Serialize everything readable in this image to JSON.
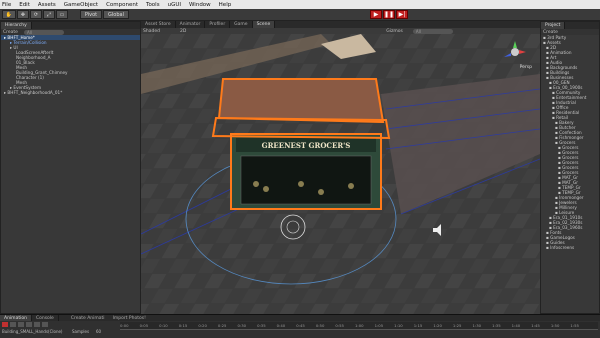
{
  "menu": [
    "File",
    "Edit",
    "Assets",
    "GameObject",
    "Component",
    "Tools",
    "uGUI",
    "Window",
    "Help"
  ],
  "toolbar": {
    "pivot": "Pivot",
    "global": "Global"
  },
  "hierarchy": {
    "tab": "Hierarchy",
    "create": "Create",
    "search": "All",
    "items": [
      {
        "label": "BHFT_Home*",
        "indent": 0,
        "cls": "sel"
      },
      {
        "label": "Terrain/Collision",
        "indent": 1,
        "cls": "blue"
      },
      {
        "label": "UI",
        "indent": 1,
        "cls": ""
      },
      {
        "label": "LoadScreenAfterIt",
        "indent": 2,
        "cls": ""
      },
      {
        "label": "Neighborhood_A",
        "indent": 2,
        "cls": ""
      },
      {
        "label": "01_Black",
        "indent": 2,
        "cls": ""
      },
      {
        "label": "Mesh",
        "indent": 2,
        "cls": ""
      },
      {
        "label": "Building_Grant_Chimney",
        "indent": 2,
        "cls": ""
      },
      {
        "label": "Character (1)",
        "indent": 2,
        "cls": ""
      },
      {
        "label": "Mesh",
        "indent": 2,
        "cls": ""
      },
      {
        "label": "EventSystem",
        "indent": 1,
        "cls": ""
      },
      {
        "label": "BHFT_NeighborhoodA_01*",
        "indent": 0,
        "cls": ""
      }
    ]
  },
  "scene": {
    "tabs": [
      "Asset Store",
      "Animator",
      "Profiler",
      "Game",
      "Scene"
    ],
    "shading": "Shaded",
    "mode": "2D",
    "gizmos": "Gizmos",
    "search": "All",
    "persp": "Persp",
    "sign": "GREENEST GROCER'S"
  },
  "project": {
    "tab": "Project",
    "create": "Create",
    "items": [
      {
        "label": "3rd Party",
        "indent": 0
      },
      {
        "label": "Assets",
        "indent": 0
      },
      {
        "label": "2D",
        "indent": 1
      },
      {
        "label": "Animation",
        "indent": 1
      },
      {
        "label": "Art",
        "indent": 1
      },
      {
        "label": "Audio",
        "indent": 1
      },
      {
        "label": "Backgrounds",
        "indent": 1
      },
      {
        "label": "Buildings",
        "indent": 1
      },
      {
        "label": "Businesses",
        "indent": 1
      },
      {
        "label": "00_GEN",
        "indent": 2
      },
      {
        "label": "Era_00_1900s",
        "indent": 2
      },
      {
        "label": "Community",
        "indent": 3
      },
      {
        "label": "Entertainment",
        "indent": 3
      },
      {
        "label": "Industrial",
        "indent": 3
      },
      {
        "label": "Office",
        "indent": 3
      },
      {
        "label": "Residential",
        "indent": 3
      },
      {
        "label": "Retail",
        "indent": 3
      },
      {
        "label": "Bakery",
        "indent": 4
      },
      {
        "label": "Butcher",
        "indent": 4
      },
      {
        "label": "Confection",
        "indent": 4
      },
      {
        "label": "Fishmonger",
        "indent": 4
      },
      {
        "label": "Grocers",
        "indent": 4
      },
      {
        "label": "Grocers",
        "indent": 5
      },
      {
        "label": "Grocers",
        "indent": 5
      },
      {
        "label": "Grocers",
        "indent": 5
      },
      {
        "label": "Grocers",
        "indent": 5
      },
      {
        "label": "Grocers",
        "indent": 5
      },
      {
        "label": "Grocers",
        "indent": 5
      },
      {
        "label": "MAT_Gr",
        "indent": 5
      },
      {
        "label": "MAT_Gr",
        "indent": 5
      },
      {
        "label": "TEMP_Gr",
        "indent": 5
      },
      {
        "label": "TEMP_Gr",
        "indent": 5
      },
      {
        "label": "Ironmonger",
        "indent": 4
      },
      {
        "label": "Jewelers",
        "indent": 4
      },
      {
        "label": "Millinery",
        "indent": 4
      },
      {
        "label": "Leisure",
        "indent": 4
      },
      {
        "label": "Era_01_1910s",
        "indent": 2
      },
      {
        "label": "Era_02_1930s",
        "indent": 2
      },
      {
        "label": "Era_03_1960s",
        "indent": 2
      },
      {
        "label": "Fonts",
        "indent": 1
      },
      {
        "label": "GameLogos",
        "indent": 1
      },
      {
        "label": "Guides",
        "indent": 1
      },
      {
        "label": "Infoscreens",
        "indent": 1
      }
    ]
  },
  "bottom": {
    "tabs": [
      "Animation",
      "Console"
    ],
    "create_anim": "Create Animati",
    "import": "Import Photos!",
    "clip": "Building_SMALL_Hands(Clone)",
    "samples": "Samples",
    "samples_val": "60",
    "ticks": [
      "0:00",
      "0:05",
      "0:10",
      "0:15",
      "0:20",
      "0:25",
      "0:30",
      "0:35",
      "0:40",
      "0:45",
      "0:50",
      "0:55",
      "1:00",
      "1:05",
      "1:10",
      "1:15",
      "1:20",
      "1:25",
      "1:30",
      "1:35",
      "1:40",
      "1:45",
      "1:50",
      "1:55"
    ]
  }
}
